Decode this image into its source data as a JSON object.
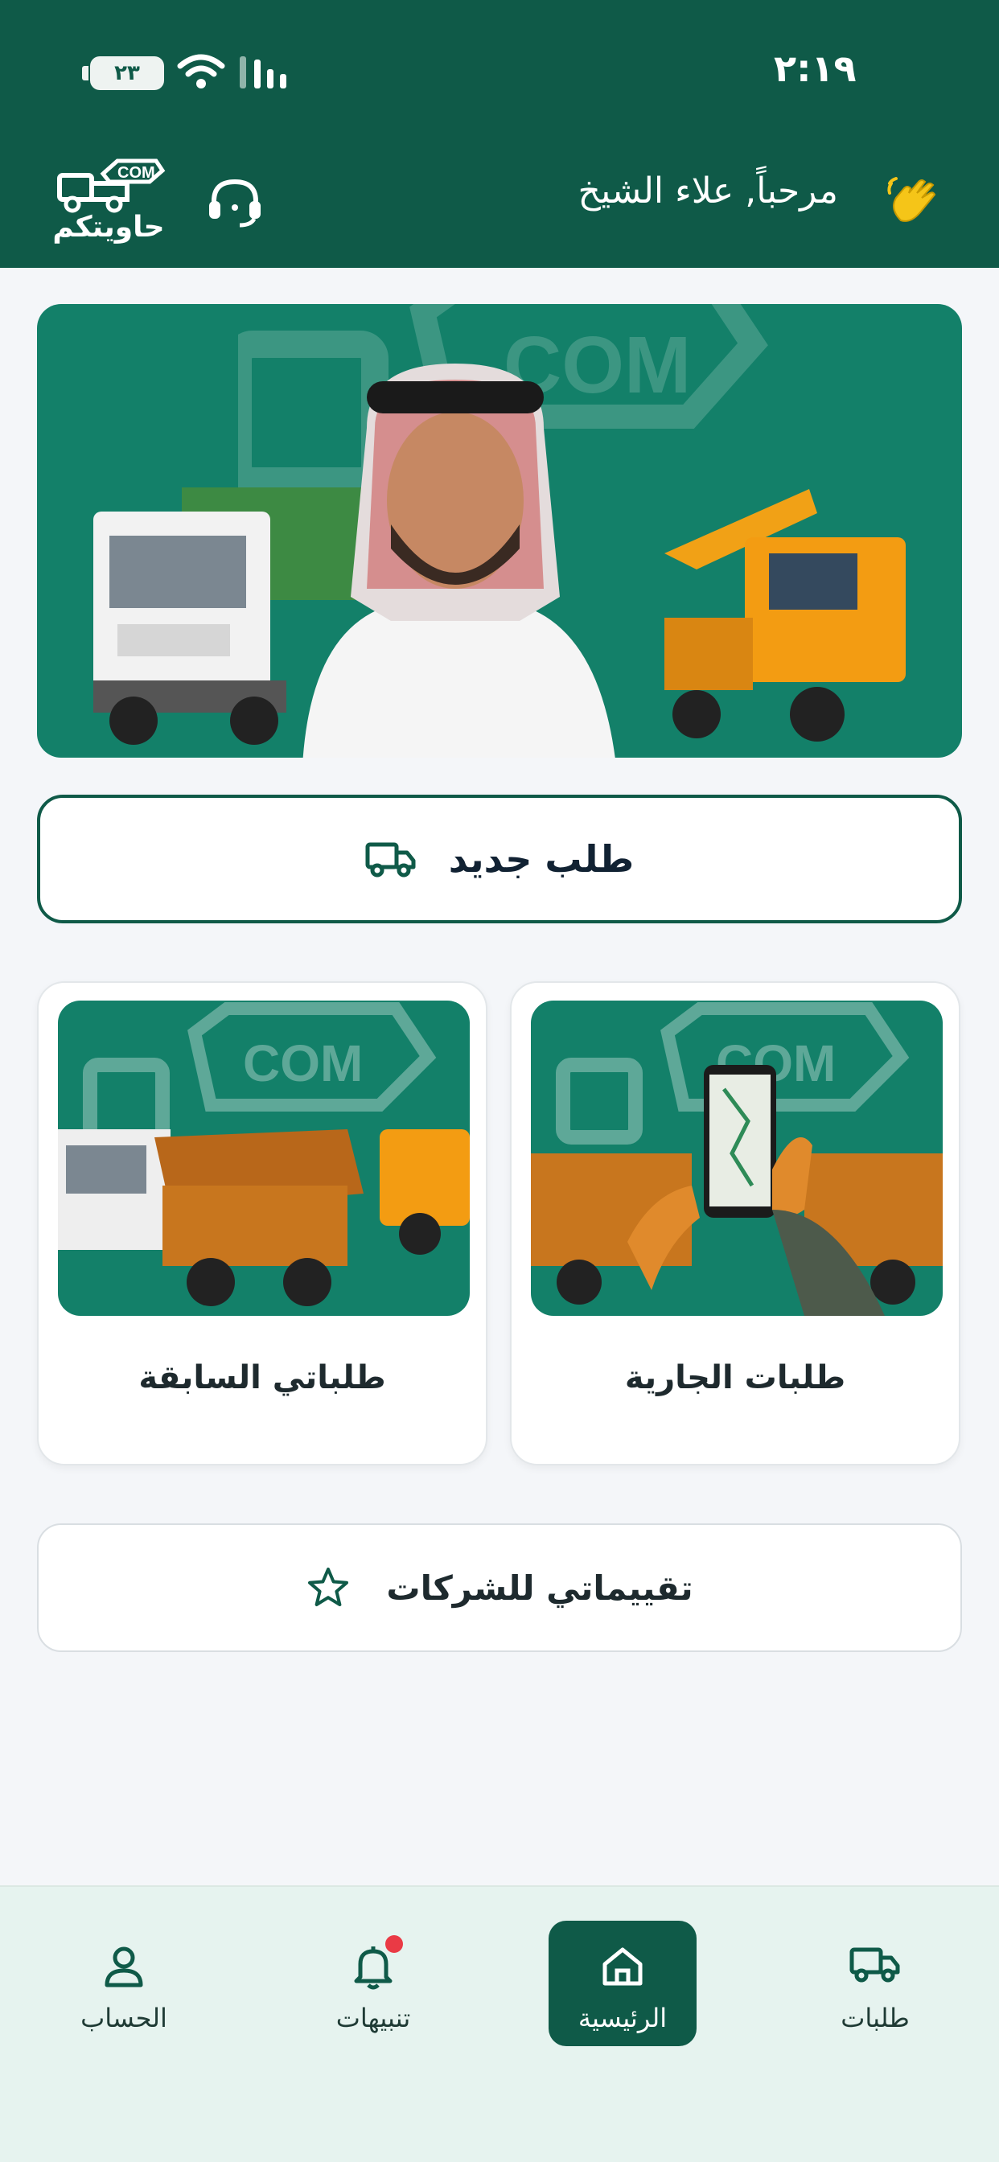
{
  "status_bar": {
    "time": "٢:١٩",
    "battery": "٢٣"
  },
  "header": {
    "logo_text": "حاويتكم",
    "logo_badge": "COM",
    "greeting": "مرحباً, علاء الشيخ"
  },
  "actions": {
    "new_order": "طلب جديد",
    "current_orders": "طلبات الجارية",
    "previous_orders": "طلباتي السابقة",
    "ratings": "تقييماتي للشركات"
  },
  "bottom_nav": {
    "orders": "طلبات",
    "home": "الرئيسية",
    "notifications": "تنبيهات",
    "account": "الحساب"
  },
  "colors": {
    "primary": "#0f5a48",
    "banner": "#138069",
    "notification_dot": "#ea3a45",
    "wave_icon": "#f5c518"
  },
  "icons": [
    "truck-logo-icon",
    "headset-icon",
    "waving-hand-icon",
    "truck-icon",
    "star-icon",
    "home-icon",
    "bell-icon",
    "user-icon"
  ]
}
